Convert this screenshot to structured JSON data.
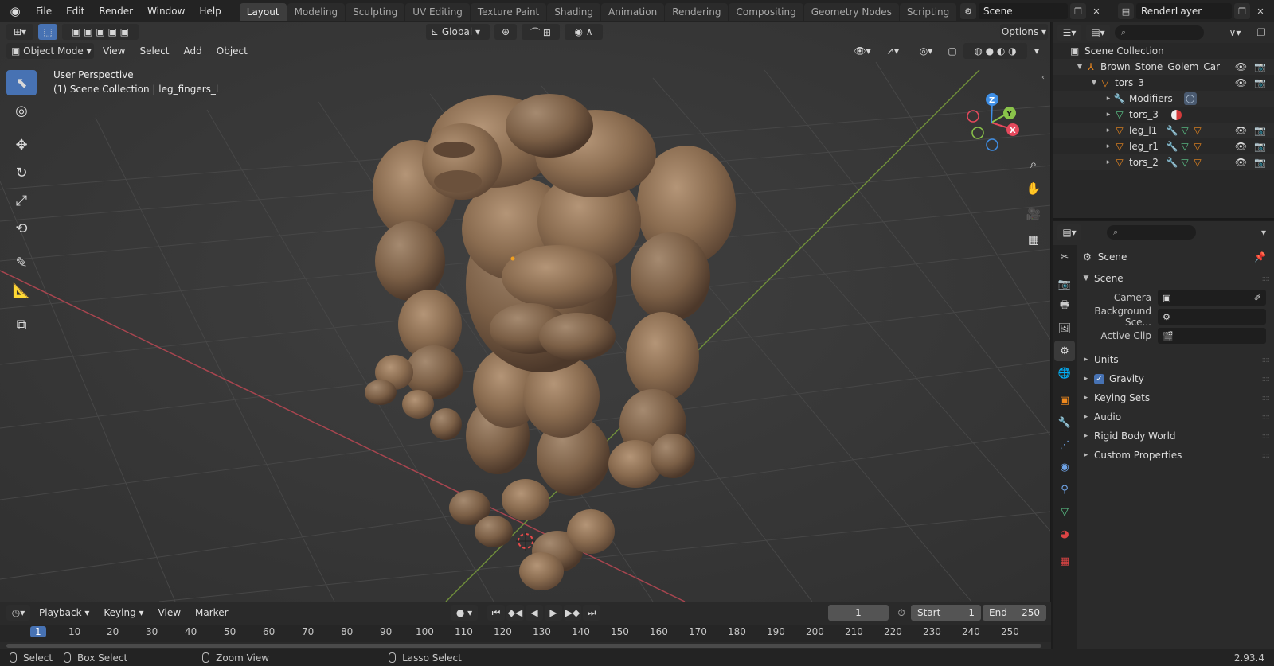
{
  "menu": {
    "file": "File",
    "edit": "Edit",
    "render": "Render",
    "window": "Window",
    "help": "Help"
  },
  "workspaces": [
    "Layout",
    "Modeling",
    "Sculpting",
    "UV Editing",
    "Texture Paint",
    "Shading",
    "Animation",
    "Rendering",
    "Compositing",
    "Geometry Nodes",
    "Scripting"
  ],
  "scene_name": "Scene",
  "view_layer": "RenderLayer",
  "viewport": {
    "transform_orientation": "Global",
    "options_label": "Options",
    "mode": "Object Mode",
    "header_menus": [
      "View",
      "Select",
      "Add",
      "Object"
    ],
    "perspective_label": "User Perspective",
    "collection_info": "(1) Scene Collection | leg_fingers_l",
    "axes": {
      "x": "X",
      "y": "Y",
      "z": "Z"
    }
  },
  "timeline": {
    "menus": [
      "Playback",
      "Keying",
      "View",
      "Marker"
    ],
    "current_frame": "1",
    "start_label": "Start",
    "start_value": "1",
    "end_label": "End",
    "end_value": "250",
    "ruler_ticks": [
      "1",
      "10",
      "20",
      "30",
      "40",
      "50",
      "60",
      "70",
      "80",
      "90",
      "100",
      "110",
      "120",
      "130",
      "140",
      "150",
      "160",
      "170",
      "180",
      "190",
      "200",
      "210",
      "220",
      "230",
      "240",
      "250"
    ]
  },
  "status_bar": {
    "select": "Select",
    "box_select": "Box Select",
    "zoom_view": "Zoom View",
    "lasso_select": "Lasso Select",
    "version": "2.93.4"
  },
  "outliner": {
    "scene_collection": "Scene Collection",
    "root_object": "Brown_Stone_Golem_Cartoon",
    "child_object": "tors_3",
    "children": [
      "Modifiers",
      "tors_3",
      "leg_l1",
      "leg_r1",
      "tors_2"
    ]
  },
  "properties": {
    "context_title": "Scene",
    "panel_title": "Scene",
    "camera_label": "Camera",
    "background_scene_label": "Background Sce...",
    "active_clip_label": "Active Clip",
    "subpanels": [
      "Units",
      "Gravity",
      "Keying Sets",
      "Audio",
      "Rigid Body World",
      "Custom Properties"
    ]
  },
  "colors": {
    "accent": "#4772b3",
    "object_orange": "#f08a1e",
    "mesh_green": "#5fcf8f",
    "axis_x": "#e5485c",
    "axis_y": "#8ac34a",
    "axis_z": "#3f8fe6"
  }
}
